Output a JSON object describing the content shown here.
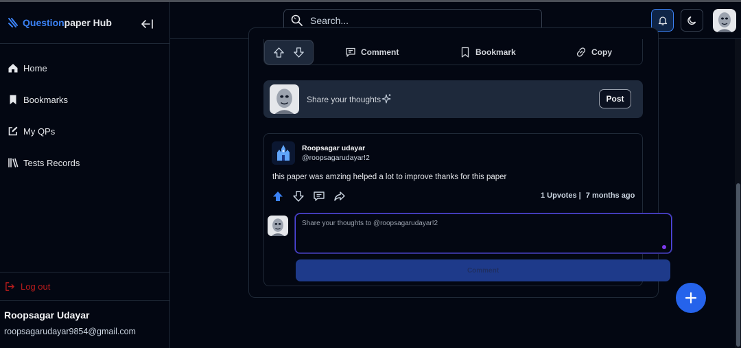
{
  "brand": {
    "part1": "Question",
    "part2": "paper Hub"
  },
  "sidebar": {
    "items": [
      {
        "label": "Home",
        "icon": "home-icon"
      },
      {
        "label": "Bookmarks",
        "icon": "bookmark-icon"
      },
      {
        "label": "My QPs",
        "icon": "edit-icon"
      },
      {
        "label": "Tests Records",
        "icon": "library-icon"
      }
    ],
    "logout_label": "Log out",
    "user": {
      "name": "Roopsagar Udayar",
      "email": "roopsagarudayar9854@gmail.com"
    }
  },
  "header": {
    "search_placeholder": "Search..."
  },
  "actions": {
    "comment": "Comment",
    "bookmark": "Bookmark",
    "copy": "Copy"
  },
  "composer": {
    "prompt": "Share your thoughts",
    "post_label": "Post"
  },
  "comment": {
    "name": "Roopsagar udayar",
    "handle": "@roopsagarudayar!2",
    "text": "this paper was amzing helped a lot to improve thanks for this paper",
    "upvotes": "1 Upvotes |",
    "time": "7 months ago"
  },
  "reply": {
    "placeholder": "Share your thoughts to @roopsagarudayar!2",
    "button_label": "Comment"
  },
  "colors": {
    "accent": "#3b82f6",
    "background": "#030712",
    "panel": "#1e293b",
    "danger": "#b91c1c"
  }
}
